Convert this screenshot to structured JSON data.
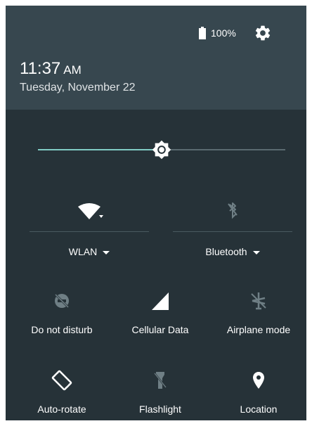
{
  "status": {
    "battery": "100%"
  },
  "header": {
    "time": "11:37",
    "ampm": "AM",
    "date": "Tuesday, November 22"
  },
  "brightness": {
    "level": 0.5
  },
  "tiles_main": [
    {
      "label": "WLAN",
      "icon": "wifi-icon",
      "state": "on"
    },
    {
      "label": "Bluetooth",
      "icon": "bluetooth-disabled-icon",
      "state": "off"
    }
  ],
  "tiles": [
    {
      "label": "Do not disturb",
      "icon": "do-not-disturb-off-icon"
    },
    {
      "label": "Cellular Data",
      "icon": "cellular-signal-icon"
    },
    {
      "label": "Airplane mode",
      "icon": "airplane-off-icon"
    },
    {
      "label": "Auto-rotate",
      "icon": "screen-rotation-icon"
    },
    {
      "label": "Flashlight",
      "icon": "flashlight-off-icon"
    },
    {
      "label": "Location",
      "icon": "location-pin-icon"
    }
  ],
  "colors": {
    "header": "#37474f",
    "panel": "#263238",
    "accent": "#80cbc4",
    "dim_icon": "#6f7f85"
  }
}
